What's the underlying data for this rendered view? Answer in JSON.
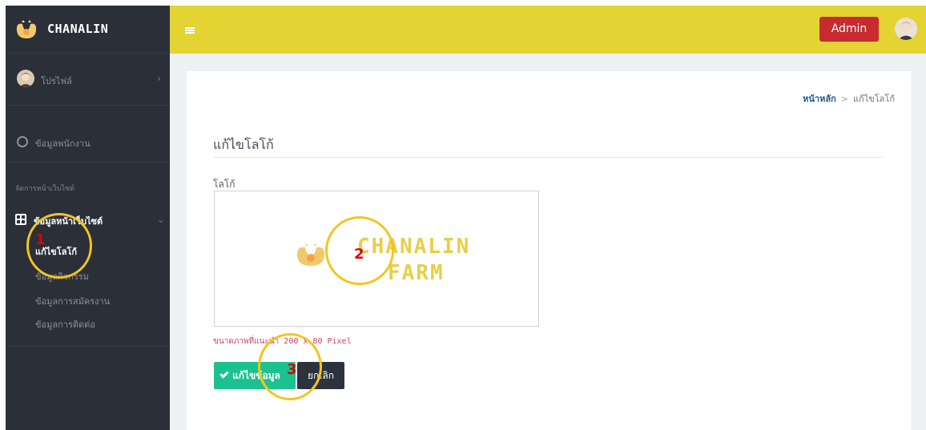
{
  "brand": {
    "name": "CHANALIN"
  },
  "sidebar": {
    "profile_label": "โปรไฟล์",
    "staff_label": "ข้อมูลพนักงาน",
    "site_section_header": "จัดการหน้าเว็บไซต์",
    "site_menu_label": "ข้อมูลหน้าเว็บไซต์",
    "sub_items": [
      {
        "label": "แก้ไขโลโก้",
        "active": true
      },
      {
        "label": "ข้อมูลกิจกรรม",
        "active": false
      },
      {
        "label": "ข้อมูลการสมัครงาน",
        "active": false
      },
      {
        "label": "ข้อมูลการติดต่อ",
        "active": false
      }
    ]
  },
  "topbar": {
    "menu_icon": "hamburger-icon",
    "admin_label": "Admin"
  },
  "breadcrumb": {
    "home": "หน้าหลัก",
    "separator": ">",
    "current": "แก้ไขโลโก้"
  },
  "main": {
    "title": "แก้ไขโลโก้",
    "logo_field_label": "โลโก้",
    "logo_preview": {
      "line1": "CHANALIN",
      "line2": "FARM"
    },
    "size_hint": "ขนาดภาพที่แนะนำ 200 x 80 Pixel",
    "save_label": "แก้ไขข้อมูล",
    "cancel_label": "ยกเลิก"
  },
  "annotations": {
    "one": "1",
    "two": "2",
    "three": "3"
  },
  "colors": {
    "sidebar_bg": "#2a2f38",
    "topbar_bg": "#e4d433",
    "admin_button": "#c72a2f",
    "save_button": "#1bc18e",
    "cancel_button": "#2c333d",
    "hint_text": "#d0426b",
    "annotation_ring": "#f3c522",
    "annotation_number": "#e00000"
  }
}
